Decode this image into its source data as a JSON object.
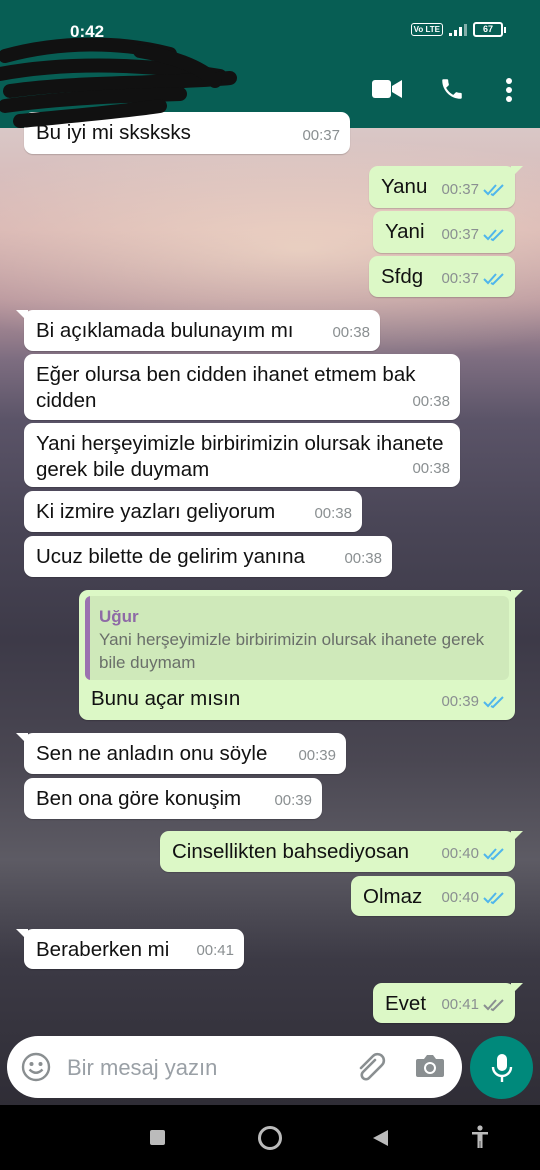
{
  "status_bar": {
    "time": "0:42",
    "network": "Vo LTE",
    "battery": "67"
  },
  "header": {
    "video_icon": "video-call-icon",
    "call_icon": "phone-icon",
    "menu_icon": "more-vert-icon"
  },
  "messages": [
    {
      "dir": "in",
      "text": "Bu iyi mi sksksks",
      "time": "00:37"
    },
    {
      "dir": "out",
      "text": "Yanu",
      "time": "00:37",
      "status": "read"
    },
    {
      "dir": "out",
      "text": "Yani",
      "time": "00:37",
      "status": "read"
    },
    {
      "dir": "out",
      "text": "Sfdg",
      "time": "00:37",
      "status": "read"
    },
    {
      "dir": "in",
      "text": "Bi açıklamada bulunayım mı",
      "time": "00:38"
    },
    {
      "dir": "in",
      "text": "Eğer olursa ben cidden ihanet etmem bak cidden",
      "time": "00:38"
    },
    {
      "dir": "in",
      "text": "Yani herşeyimizle birbirimizin olursak ihanete gerek bile duymam",
      "time": "00:38"
    },
    {
      "dir": "in",
      "text": "Ki izmire yazları geliyorum",
      "time": "00:38"
    },
    {
      "dir": "in",
      "text": "Ucuz bilette de gelirim yanına",
      "time": "00:38"
    },
    {
      "dir": "out",
      "text": "Bunu açar mısın",
      "time": "00:39",
      "status": "read",
      "quote": {
        "author": "Uğur",
        "text": "Yani herşeyimizle birbirimizin olursak ihanete gerek bile duymam"
      }
    },
    {
      "dir": "in",
      "text": "Sen ne anladın onu söyle",
      "time": "00:39"
    },
    {
      "dir": "in",
      "text": "Ben ona göre konuşim",
      "time": "00:39"
    },
    {
      "dir": "out",
      "text": "Cinsellikten bahsediyosan",
      "time": "00:40",
      "status": "read"
    },
    {
      "dir": "out",
      "text": "Olmaz",
      "time": "00:40",
      "status": "read"
    },
    {
      "dir": "in",
      "text": "Beraberken mi",
      "time": "00:41"
    },
    {
      "dir": "out",
      "text": "Evet",
      "time": "00:41",
      "status": "delivered"
    }
  ],
  "composer": {
    "placeholder": "Bir mesaj yazın"
  },
  "colors": {
    "header": "#075e54",
    "incoming": "#ffffff",
    "outgoing": "#dcf8c6",
    "read_tick": "#4fb6ec",
    "delivered_tick": "#8a8f91",
    "accent": "#00897b"
  }
}
